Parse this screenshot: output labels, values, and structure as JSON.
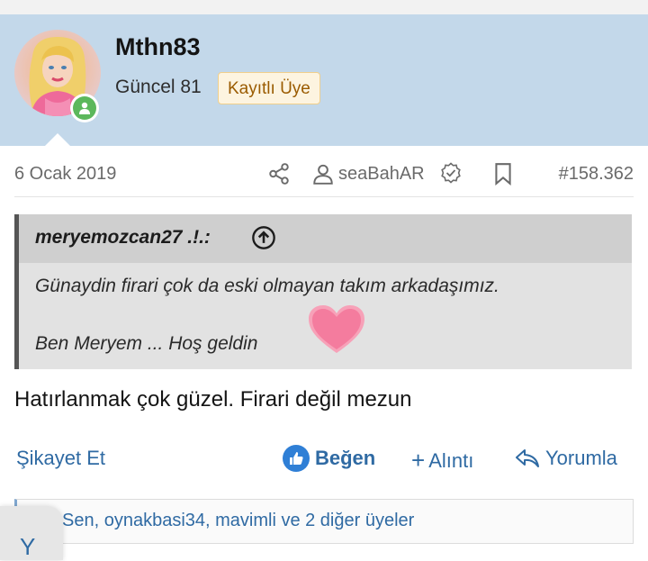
{
  "user": {
    "name": "Mthn83",
    "title": "Güncel 81",
    "badge": "Kayıtlı Üye",
    "avatar_icon": "avatar-image",
    "status_icon": "online-user-icon"
  },
  "meta": {
    "date": "6 Ocak 2019",
    "share_icon": "share-icon",
    "user_icon": "user-icon",
    "author": "seaBahAR",
    "verified_icon": "verified-icon",
    "bookmark_icon": "bookmark-icon",
    "post_number": "#158.362"
  },
  "quote": {
    "author": "meryemozcan27 .!.:",
    "expand_icon": "arrow-up-circle-icon",
    "line1": "Günaydin firari çok da eski olmayan takım arkadaşımız.",
    "line2": "Ben Meryem ... Hoş geldin",
    "emoji": "heart-emoji"
  },
  "post": {
    "body": "Hatırlanmak çok güzel. Firari değil mezun"
  },
  "actions": {
    "report": "Şikayet Et",
    "like": "Beğen",
    "quote": "Alıntı",
    "quote_prefix": "+",
    "reply": "Yorumla"
  },
  "reactions": {
    "text": "Sen, oynakbasi34, mavimli ve 2 diğer üyeler"
  },
  "fab": {
    "label": "Y"
  },
  "colors": {
    "header_bg": "#c3d8ea",
    "link": "#2f6aa3",
    "online": "#5cb85c",
    "badge_bg": "#fdf4e0",
    "badge_text": "#9a5b00"
  }
}
